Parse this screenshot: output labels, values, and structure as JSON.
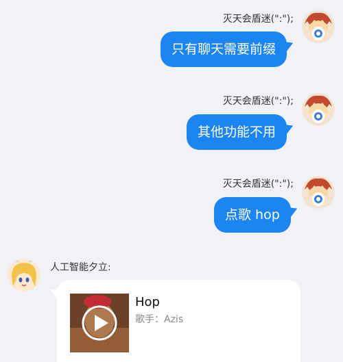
{
  "messages": [
    {
      "sender": "灭天会盾迷(\":\");",
      "text": "只有聊天需要前缀"
    },
    {
      "sender": "灭天会盾迷(\":\");",
      "text": "其他功能不用"
    },
    {
      "sender": "灭天会盾迷(\":\");",
      "text": "点歌 hop"
    }
  ],
  "bot": {
    "sender": "人工智能夕立:",
    "card": {
      "title": "Hop",
      "artist": "歌手：Azis",
      "play_icon": "play-icon"
    }
  },
  "colors": {
    "background": "#f1f2f6",
    "bubble": "#1c85f2",
    "card": "#ffffff"
  }
}
